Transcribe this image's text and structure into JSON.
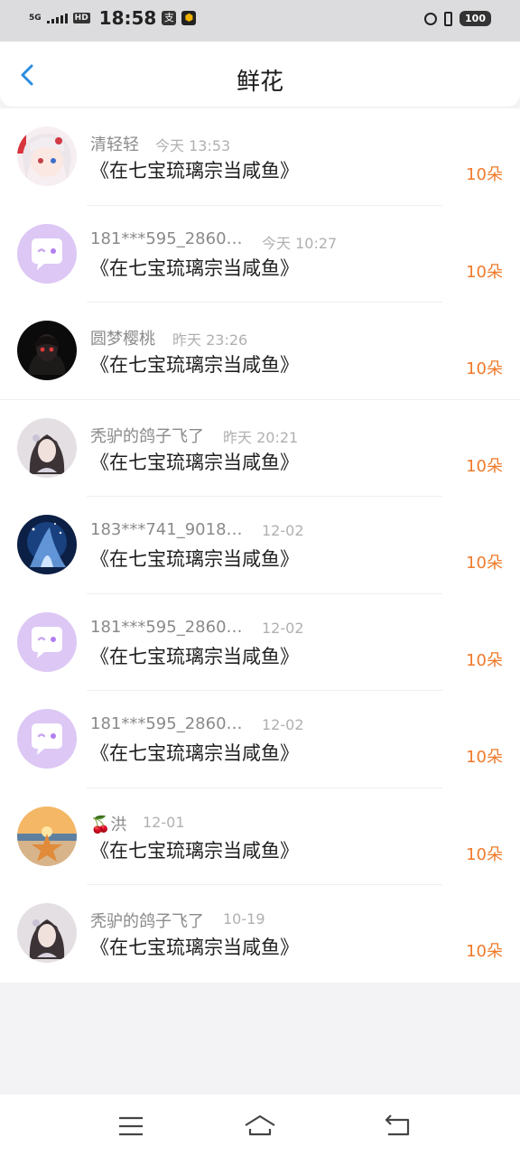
{
  "status_bar": {
    "network": "5G",
    "hd": "HD",
    "time": "18:58",
    "app1": "支",
    "app2": "⬢",
    "battery": "100"
  },
  "header": {
    "title": "鲜花"
  },
  "items": [
    {
      "user": "清轻轻",
      "time": "今天 13:53",
      "book": "《在七宝琉璃宗当咸鱼》",
      "count": "10朵",
      "avatar": "anime-girl"
    },
    {
      "user": "181***595_2860…",
      "time": "今天 10:27",
      "book": "《在七宝琉璃宗当咸鱼》",
      "count": "10朵",
      "avatar": "default-chat"
    },
    {
      "user": "圆梦樱桃",
      "time": "昨天 23:26",
      "book": "《在七宝琉璃宗当咸鱼》",
      "count": "10朵",
      "avatar": "dark-portrait"
    },
    {
      "user": "秃驴的鸽子飞了",
      "time": "昨天 20:21",
      "book": "《在七宝琉璃宗当咸鱼》",
      "count": "10朵",
      "avatar": "ancient-lady"
    },
    {
      "user": "183***741_9018…",
      "time": "12-02",
      "book": "《在七宝琉璃宗当咸鱼》",
      "count": "10朵",
      "avatar": "blue-fantasy"
    },
    {
      "user": "181***595_2860…",
      "time": "12-02",
      "book": "《在七宝琉璃宗当咸鱼》",
      "count": "10朵",
      "avatar": "default-chat"
    },
    {
      "user": "181***595_2860…",
      "time": "12-02",
      "book": "《在七宝琉璃宗当咸鱼》",
      "count": "10朵",
      "avatar": "default-chat"
    },
    {
      "user": "🍒洪",
      "time": "12-01",
      "book": "《在七宝琉璃宗当咸鱼》",
      "count": "10朵",
      "avatar": "starfish-beach"
    },
    {
      "user": "秃驴的鸽子飞了",
      "time": "10-19",
      "book": "《在七宝琉璃宗当咸鱼》",
      "count": "10朵",
      "avatar": "ancient-lady"
    }
  ],
  "colors": {
    "accent": "#2a8de0",
    "count": "#f07a2a",
    "default_avatar": "#dcc7f5"
  }
}
